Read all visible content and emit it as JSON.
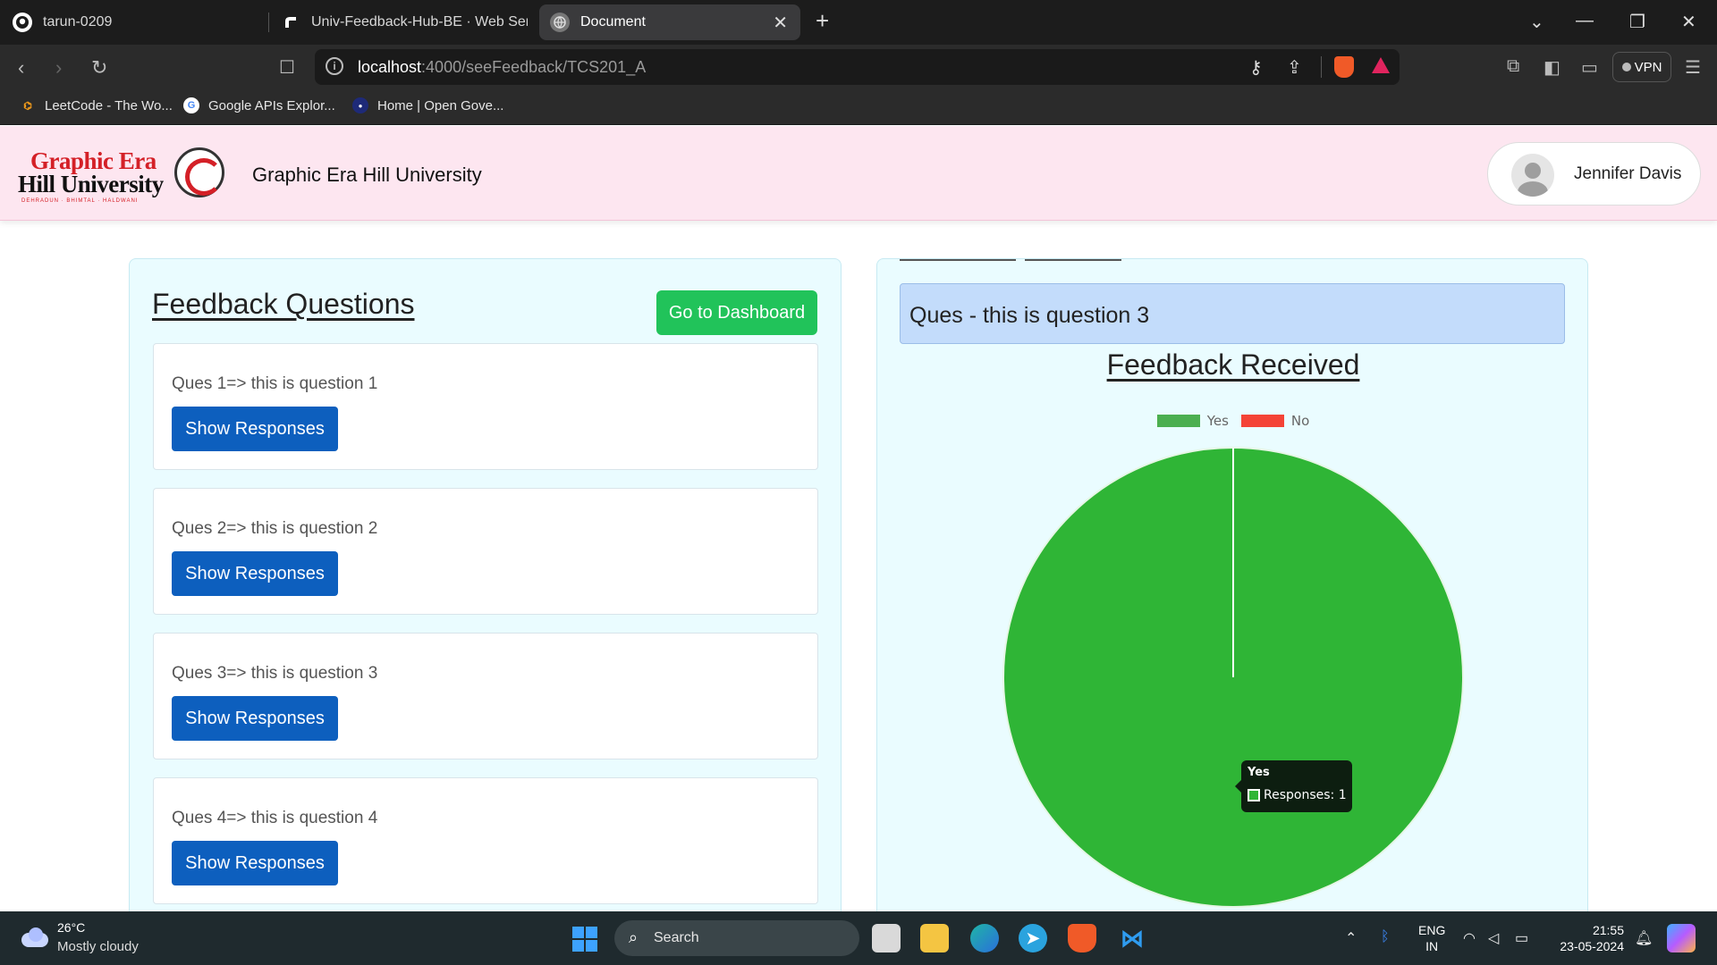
{
  "browser": {
    "tabs": [
      {
        "label": "tarun-0209",
        "icon": "github-icon"
      },
      {
        "label": "Univ-Feedback-Hub-BE · Web Servic",
        "icon": "render-icon"
      },
      {
        "label": "Document",
        "icon": "globe-icon"
      }
    ],
    "url_host": "localhost",
    "url_path": ":4000/seeFeedback/TCS201_A",
    "vpn_label": "VPN",
    "bookmarks": [
      {
        "label": "LeetCode - The Wo..."
      },
      {
        "label": "Google APIs Explor..."
      },
      {
        "label": "Home | Open Gove..."
      }
    ]
  },
  "header": {
    "logo_line1": "Graphic Era",
    "logo_line2": "Hill University",
    "logo_tagline": "DEHRADUN · BHIMTAL · HALDWANI",
    "site_title": "Graphic Era Hill University",
    "user_name": "Jennifer Davis"
  },
  "feedback": {
    "title": "Feedback Questions",
    "dashboard_button": "Go to Dashboard",
    "questions": [
      {
        "text": "Ques 1=> this is question 1",
        "button": "Show Responses"
      },
      {
        "text": "Ques 2=> this is question 2",
        "button": "Show Responses"
      },
      {
        "text": "Ques 3=> this is question 3",
        "button": "Show Responses"
      },
      {
        "text": "Ques 4=> this is question 4",
        "button": "Show Responses"
      }
    ]
  },
  "responses": {
    "selected_question": "Ques - this is question 3",
    "title": "Feedback Received",
    "tooltip": {
      "title": "Yes",
      "body": "Responses: 1"
    }
  },
  "chart_data": {
    "type": "pie",
    "categories": [
      "Yes",
      "No"
    ],
    "values": [
      1,
      0
    ],
    "colors": [
      "#2fb536",
      "#f44336"
    ],
    "legend_colors": [
      "#4caf50",
      "#f44336"
    ],
    "legend_position": "top"
  },
  "taskbar": {
    "temperature": "26°C",
    "weather": "Mostly cloudy",
    "search_placeholder": "Search",
    "lang_line1": "ENG",
    "lang_line2": "IN",
    "time": "21:55",
    "date": "23-05-2024"
  }
}
